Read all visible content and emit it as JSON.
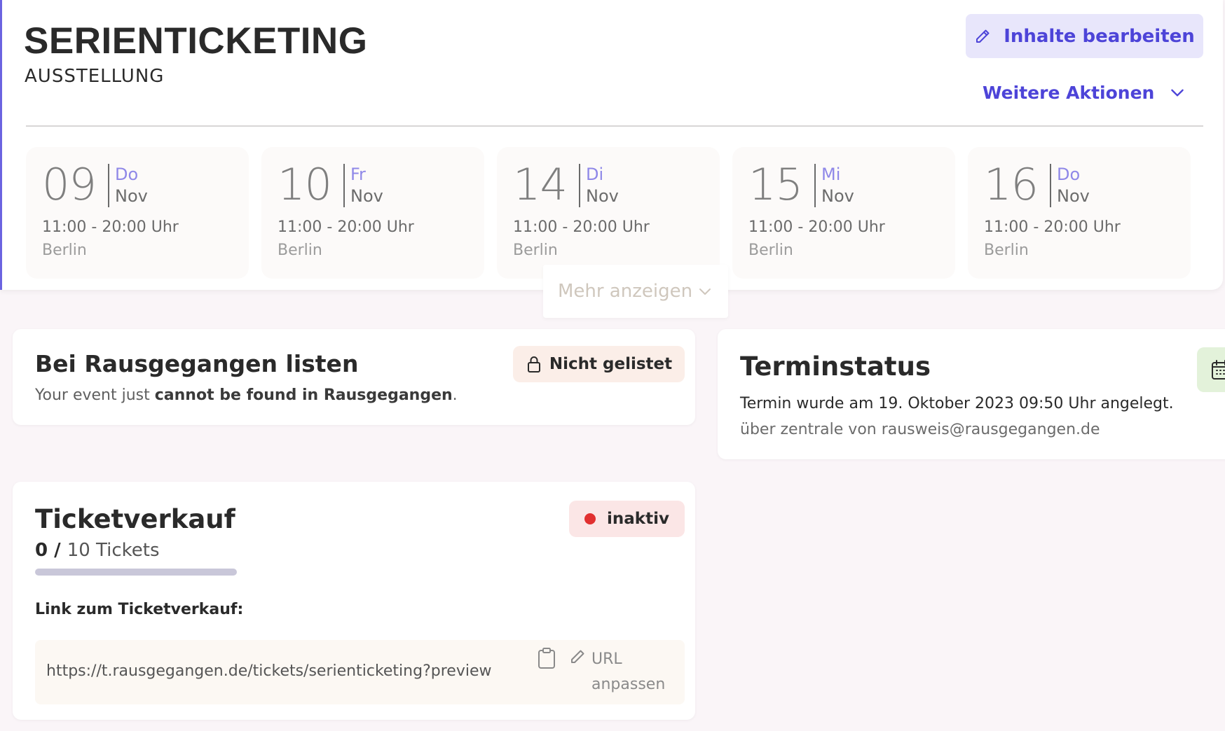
{
  "event": {
    "title": "SERIENTICKETING",
    "type": "AUSSTELLUNG"
  },
  "header": {
    "edit_label": "Inhalte bearbeiten",
    "more_actions_label": "Weitere Aktionen",
    "show_more_label": "Mehr anzeigen"
  },
  "dates": [
    {
      "day": "09",
      "weekday": "Do",
      "month": "Nov",
      "time": "11:00 - 20:00 Uhr",
      "city": "Berlin"
    },
    {
      "day": "10",
      "weekday": "Fr",
      "month": "Nov",
      "time": "11:00 - 20:00 Uhr",
      "city": "Berlin"
    },
    {
      "day": "14",
      "weekday": "Di",
      "month": "Nov",
      "time": "11:00 - 20:00 Uhr",
      "city": "Berlin"
    },
    {
      "day": "15",
      "weekday": "Mi",
      "month": "Nov",
      "time": "11:00 - 20:00 Uhr",
      "city": "Berlin"
    },
    {
      "day": "16",
      "weekday": "Do",
      "month": "Nov",
      "time": "11:00 - 20:00 Uhr",
      "city": "Berlin"
    }
  ],
  "listing": {
    "title": "Bei Rausgegangen listen",
    "text_before": "Your event just ",
    "text_bold": "cannot be found in Rausgegangen",
    "text_after": ".",
    "badge_label": "Nicht gelistet"
  },
  "status": {
    "title": "Terminstatus",
    "created_text": "Termin wurde am 19. Oktober 2023 09:50 Uhr angelegt.",
    "by_text": "über zentrale von rausweis@rausgegangen.de"
  },
  "tickets": {
    "title": "Ticketverkauf",
    "sold": "0",
    "separator": " / ",
    "total": "10",
    "unit": " Tickets",
    "progress_fraction": 0,
    "status_label": "inaktiv",
    "link_label": "Link zum Ticketverkauf:",
    "url": "https://t.rausgegangen.de/tickets/serienticketing?preview",
    "adjust_label": "URL anpassen"
  },
  "colors": {
    "accent": "#4d44d8",
    "weekday": "#8f88e8",
    "inactive_dot": "#e13030",
    "calendar_button": "#e3f2da"
  },
  "icons": {
    "edit": "pencil-icon",
    "more_actions": "chevron-down-icon",
    "listing": "lock-icon",
    "status": "calendar-icon",
    "copy": "clipboard-icon"
  }
}
